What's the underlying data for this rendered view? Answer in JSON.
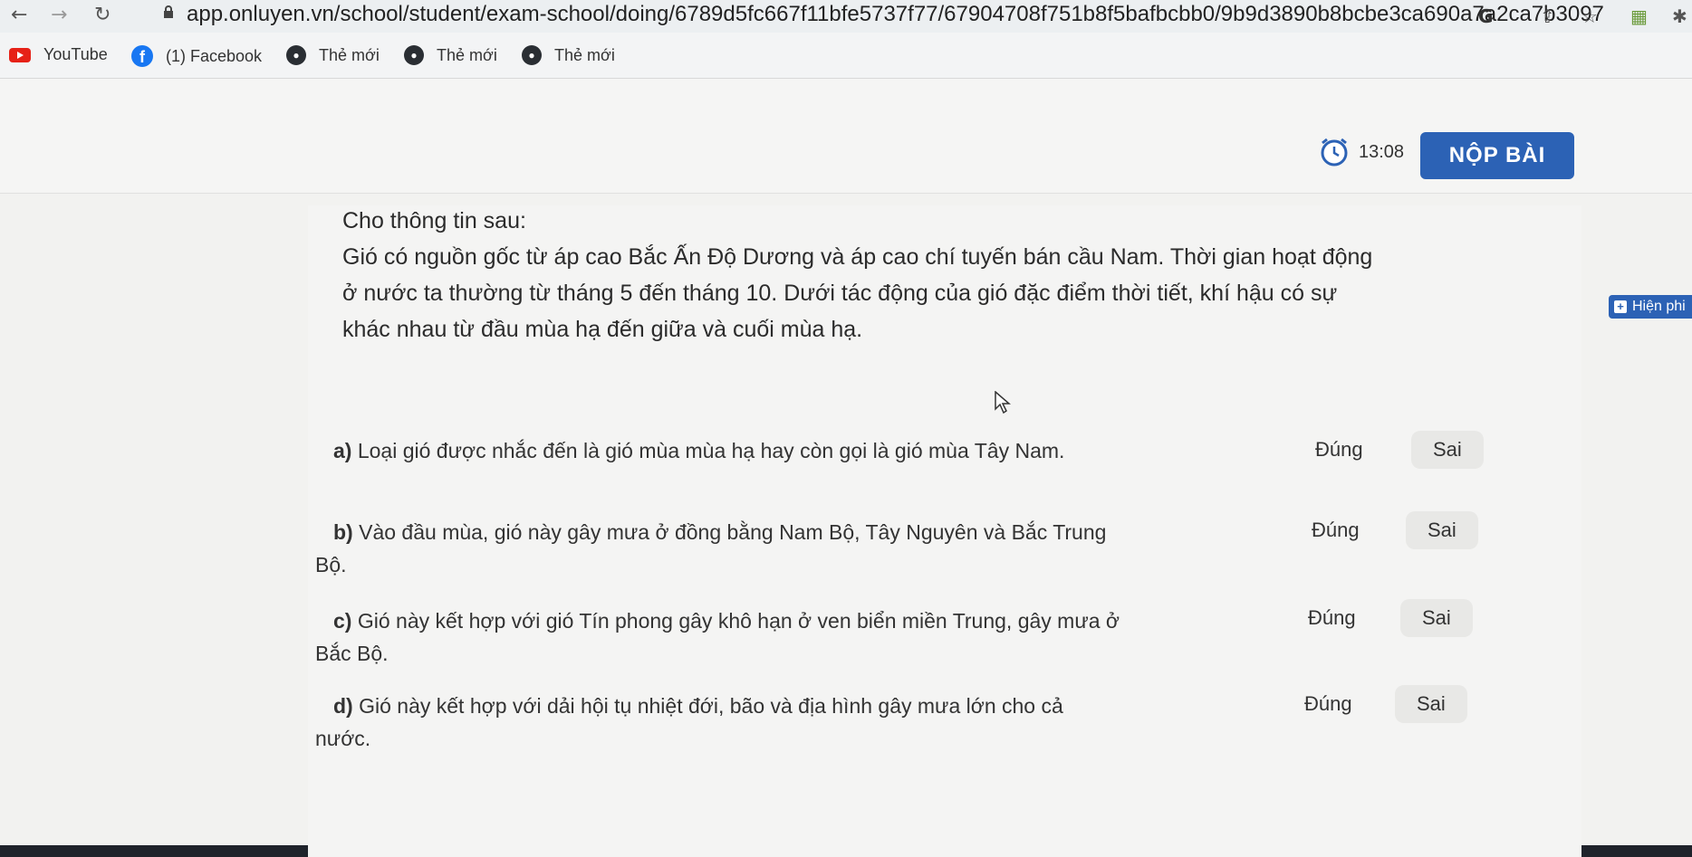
{
  "browser": {
    "url": "app.onluyen.vn/school/student/exam-school/doing/6789d5fc667f11bfe5737f77/67904708f751b8f5bafbcbb0/9b9d3890b8bcbe3ca690a7a2ca7b3097",
    "bookmarks": [
      "YouTube",
      "(1) Facebook",
      "Thẻ mới",
      "Thẻ mới",
      "Thẻ mới"
    ]
  },
  "header": {
    "timer": "13:08",
    "submit_label": "NỘP BÀI"
  },
  "side_button": {
    "label": "Hiện phi"
  },
  "question": {
    "intro": "Cho thông tin sau:",
    "passage": [
      "Gió có nguồn gốc từ áp cao Bắc Ấn Độ Dương và áp cao chí tuyến bán cầu Nam. Thời gian hoạt động",
      "ở nước ta thường từ tháng 5 đến tháng 10. Dưới tác động của gió đặc điểm thời tiết, khí hậu có sự",
      "khác nhau từ đầu mùa hạ đến giữa và cuối mùa hạ."
    ],
    "statements": [
      {
        "letter": "a)",
        "lines": [
          "Loại gió được nhắc đến là gió mùa mùa hạ hay còn gọi là gió mùa Tây Nam."
        ],
        "true_label": "Đúng",
        "false_label": "Sai"
      },
      {
        "letter": "b)",
        "lines": [
          "Vào đầu mùa, gió này gây mưa ở đồng bằng Nam Bộ, Tây Nguyên và Bắc Trung",
          "Bộ."
        ],
        "true_label": "Đúng",
        "false_label": "Sai"
      },
      {
        "letter": "c)",
        "lines": [
          "Gió này kết hợp với gió Tín phong gây khô hạn ở ven biển miền Trung, gây mưa ở",
          "Bắc Bộ."
        ],
        "true_label": "Đúng",
        "false_label": "Sai"
      },
      {
        "letter": "d)",
        "lines": [
          "Gió này kết hợp với dải hội tụ nhiệt đới, bão và địa hình gây mưa lớn cho cả",
          "nước."
        ],
        "true_label": "Đúng",
        "false_label": "Sai"
      }
    ]
  }
}
